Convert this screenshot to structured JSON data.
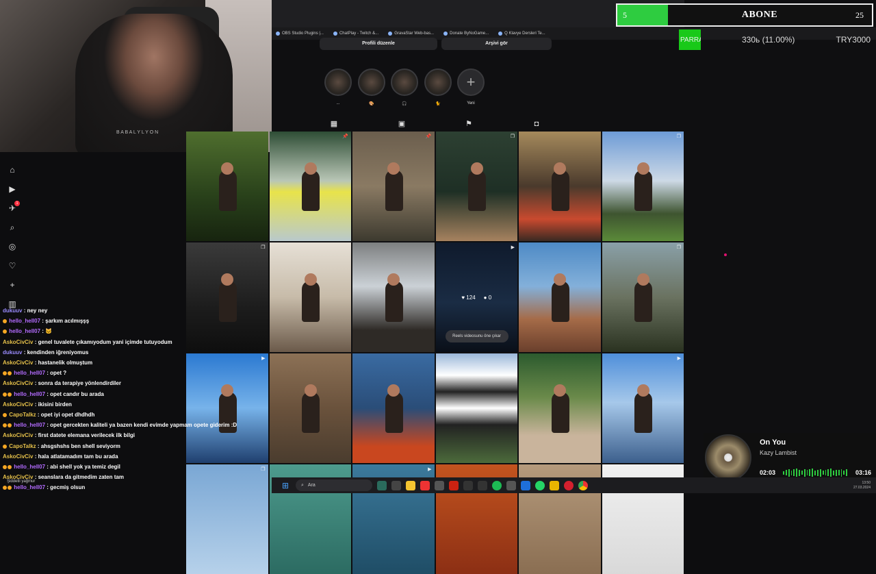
{
  "webcam": {
    "watermark": "B A B A L Y L Y O N"
  },
  "subs_bar": {
    "current": "5",
    "label": "ABONE",
    "goal": "25",
    "progress": 0.2,
    "color": "#2ecc40"
  },
  "ticker": {
    "left_label": "PARRA:)",
    "middle": "330ь (11.00%)",
    "right": "TRY3000"
  },
  "bookmarks": [
    "OBS Studio Plugins |...",
    "ChatPlay - Twitch &...",
    "GravaStar Web-bas...",
    "Donate ByNoGame...",
    "Q Klavye Dersleri Te..."
  ],
  "profile": {
    "edit_button": "Profili düzenle",
    "archive_button": "Arşivi gör"
  },
  "highlights": [
    {
      "caption": "..."
    },
    {
      "caption": "🎨"
    },
    {
      "caption": "🎧"
    },
    {
      "caption": "🐈"
    },
    {
      "caption": "Yeni"
    }
  ],
  "post_tabs": [
    {
      "name": "posts",
      "icon": "grid-icon"
    },
    {
      "name": "reels",
      "icon": "reels-icon"
    },
    {
      "name": "saved",
      "icon": "bookmark-icon"
    },
    {
      "name": "tagged",
      "icon": "tagged-icon"
    }
  ],
  "grid_overlay": {
    "likes": "124",
    "comments": "0",
    "reels_button": "Reels videosunu öne çıkar"
  },
  "grid_cells": [
    {
      "type": "",
      "bg": "linear-gradient(180deg,#4f6e2e,#28401a 60%,#17240f)"
    },
    {
      "type": "pin",
      "bg": "linear-gradient(180deg,#2e4d35,#b9c6b6 45%,#e8e34a 55%,#b9c9cc)"
    },
    {
      "type": "pin",
      "bg": "linear-gradient(180deg,#6b5e4d,#8a7a63 50%,#3d3a2f)"
    },
    {
      "type": "multi",
      "bg": "linear-gradient(180deg,#2d4032,#1e2f25 55%,#a6825f)"
    },
    {
      "type": "",
      "bg": "linear-gradient(180deg,#a58a5c,#4a3a2c 50%,#c94a2f 80%,#3a2a22)"
    },
    {
      "type": "multi",
      "bg": "linear-gradient(180deg,#6d9bd6,#cdd9e6 45%,#3e5430 75%,#5b8a39)"
    },
    {
      "type": "multi",
      "bg": "linear-gradient(180deg,#3a3a3a,#1c1c1c 60%,#0e0e0e)"
    },
    {
      "type": "",
      "bg": "linear-gradient(180deg,#e6e0d6,#c7bba9 50%,#6b5a4a)"
    },
    {
      "type": "",
      "bg": "linear-gradient(180deg,#7d7f80,#cbd1d6 40%,#2e2a26 80%)"
    },
    {
      "type": "reel",
      "bg": "linear-gradient(180deg,#0f1a2c,#1a2c44 55%,#0a0f18)"
    },
    {
      "type": "",
      "bg": "linear-gradient(180deg,#4e8ac5,#83b0da 40%,#a56b48 70%,#6a3f2c)"
    },
    {
      "type": "multi",
      "bg": "linear-gradient(180deg,#8aa0a8,#6a7260 50%,#2a3220)"
    },
    {
      "type": "reel",
      "bg": "linear-gradient(180deg,#2b79d1,#77b3ea 50%,#1f3f6e)"
    },
    {
      "type": "",
      "bg": "linear-gradient(180deg,#8c7156,#6a523c 50%,#4a3c2e)"
    },
    {
      "type": "",
      "bg": "linear-gradient(180deg,#3a6ba2,#2a4d78 50%,#c9471f 85%)"
    },
    {
      "type": "",
      "bg": "linear-gradient(180deg,#9ab7d9,#ffffff 20%,#222 35%,#fff 50%,#222 65%,#4c6b3b)"
    },
    {
      "type": "",
      "bg": "linear-gradient(180deg,#2c5a2e,#6a8a4a 40%,#c9b49c 75%)"
    },
    {
      "type": "reel",
      "bg": "linear-gradient(180deg,#4f8fda,#a6c8ea 45%,#3c5f8c)"
    },
    {
      "type": "multi",
      "bg": "linear-gradient(180deg,#7aa7d4,#b6d1ea)"
    },
    {
      "type": "",
      "bg": "linear-gradient(180deg,#4d9b8d,#2c6b62)"
    },
    {
      "type": "reel",
      "bg": "linear-gradient(180deg,#3c7a9c,#1f4d66)"
    },
    {
      "type": "",
      "bg": "linear-gradient(180deg,#c3541f,#8c2f14)"
    },
    {
      "type": "",
      "bg": "linear-gradient(180deg,#b59a7c,#8a6e52)"
    },
    {
      "type": "",
      "bg": "linear-gradient(180deg,#f1f1f1,#d9d9d9)"
    }
  ],
  "nav": [
    {
      "name": "home-icon",
      "glyph": "⌂"
    },
    {
      "name": "reels-nav-icon",
      "glyph": "▶"
    },
    {
      "name": "messages-icon",
      "glyph": "✈",
      "badge": "1"
    },
    {
      "name": "search-icon",
      "glyph": "⌕"
    },
    {
      "name": "explore-icon",
      "glyph": "◎"
    },
    {
      "name": "notifications-icon",
      "glyph": "♡"
    },
    {
      "name": "create-icon",
      "glyph": "+"
    },
    {
      "name": "dashboard-icon",
      "glyph": "▥"
    }
  ],
  "chat": [
    {
      "user": "dukuuv",
      "color": "#9b8cff",
      "badges": 0,
      "text": ": ney ney"
    },
    {
      "user": "hello_hell07",
      "color": "#b36bff",
      "badges": 1,
      "text": ": şarkım acılmışşş"
    },
    {
      "user": "hello_hell07",
      "color": "#b36bff",
      "badges": 1,
      "text": ": 🐱"
    },
    {
      "user": "AskoCivCiv",
      "color": "#e6c14a",
      "badges": 0,
      "text": ": genel tuvalete çıkamıyodum yani içimde tutuyodum"
    },
    {
      "user": "dukuuv",
      "color": "#9b8cff",
      "badges": 0,
      "text": ": kendinden iğreniyomus"
    },
    {
      "user": "AskoCivCiv",
      "color": "#e6c14a",
      "badges": 0,
      "text": ": hastanelik olmuştum"
    },
    {
      "user": "hello_hell07",
      "color": "#b36bff",
      "badges": 2,
      "text": ": opet ?"
    },
    {
      "user": "AskoCivCiv",
      "color": "#e6c14a",
      "badges": 0,
      "text": ": sonra da terapiye yönlendirdiler"
    },
    {
      "user": "hello_hell07",
      "color": "#b36bff",
      "badges": 2,
      "text": ": opet candır bu arada"
    },
    {
      "user": "AskoCivCiv",
      "color": "#e6c14a",
      "badges": 0,
      "text": ": ikisini birden"
    },
    {
      "user": "CapoTalkz",
      "color": "#e6c14a",
      "badges": 1,
      "text": ": opet iyi opet dhdhdh"
    },
    {
      "user": "hello_hell07",
      "color": "#b36bff",
      "badges": 2,
      "text": ": opet gercekten kaliteli ya bazen kendi evimde yapmam opete giderim :D"
    },
    {
      "user": "AskoCivCiv",
      "color": "#e6c14a",
      "badges": 0,
      "text": ": first datete elemana verilecek ilk bilgi"
    },
    {
      "user": "CapoTalkz",
      "color": "#e6c14a",
      "badges": 1,
      "text": ": ahsgshshs ben shell seviyorm"
    },
    {
      "user": "AskoCivCiv",
      "color": "#e6c14a",
      "badges": 0,
      "text": ": hala atlatamadım tam bu arada"
    },
    {
      "user": "hello_hell07",
      "color": "#b36bff",
      "badges": 2,
      "text": ": abi shell yok ya temiz degil"
    },
    {
      "user": "AskoCivCiv",
      "color": "#e6c14a",
      "badges": 0,
      "text": ": seanslara da gitmedim zaten tam"
    },
    {
      "user": "hello_hell07",
      "color": "#b36bff",
      "badges": 2,
      "text": ": gecmiş olsun"
    }
  ],
  "weather": "Şiddetli yağmur",
  "music": {
    "title": "On You",
    "artist": "Kazy Lambist",
    "elapsed": "02:03",
    "duration": "03:16",
    "progress": 0.63,
    "accent": "#2ecc40"
  },
  "taskbar": {
    "search": "Ara",
    "time": "13:50",
    "date": "27.03.2024"
  }
}
